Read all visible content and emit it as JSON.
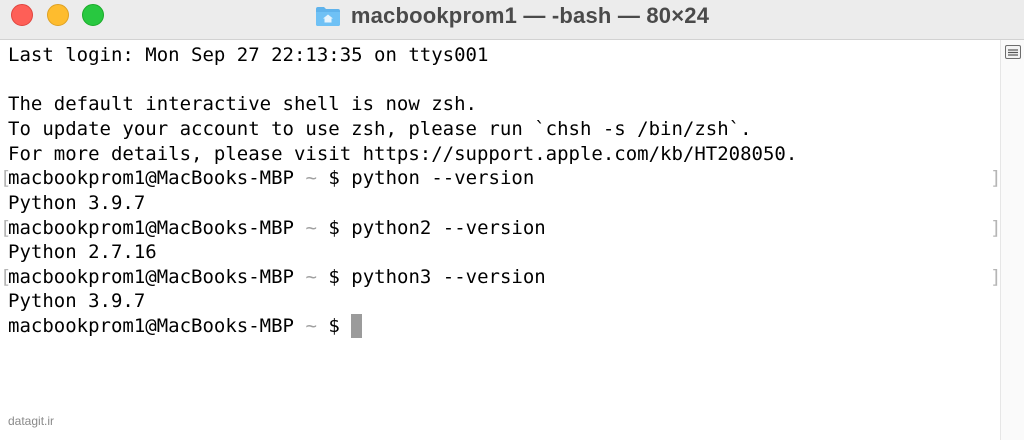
{
  "window": {
    "title": "macbookprom1 — -bash — 80×24"
  },
  "terminal": {
    "last_login": "Last login: Mon Sep 27 22:13:35 on ttys001",
    "notice_1": "The default interactive shell is now zsh.",
    "notice_2": "To update your account to use zsh, please run `chsh -s /bin/zsh`.",
    "notice_3": "For more details, please visit https://support.apple.com/kb/HT208050.",
    "prompt_host": "macbookprom1@MacBooks-MBP",
    "prompt_tilde": "~",
    "prompt_symbol": "$",
    "commands": [
      {
        "cmd": "python --version",
        "output": "Python 3.9.7"
      },
      {
        "cmd": "python2 --version",
        "output": "Python 2.7.16"
      },
      {
        "cmd": "python3 --version",
        "output": "Python 3.9.7"
      }
    ],
    "bracket_left": "[",
    "bracket_right": "]"
  },
  "watermark": "datagit.ir",
  "colors": {
    "close": "#fe5f57",
    "minimize": "#febc2e",
    "zoom": "#28c840",
    "cursor": "#9b9b9b"
  },
  "icons": {
    "title_icon": "folder-home-icon",
    "scrollbar_icon": "list-icon"
  }
}
